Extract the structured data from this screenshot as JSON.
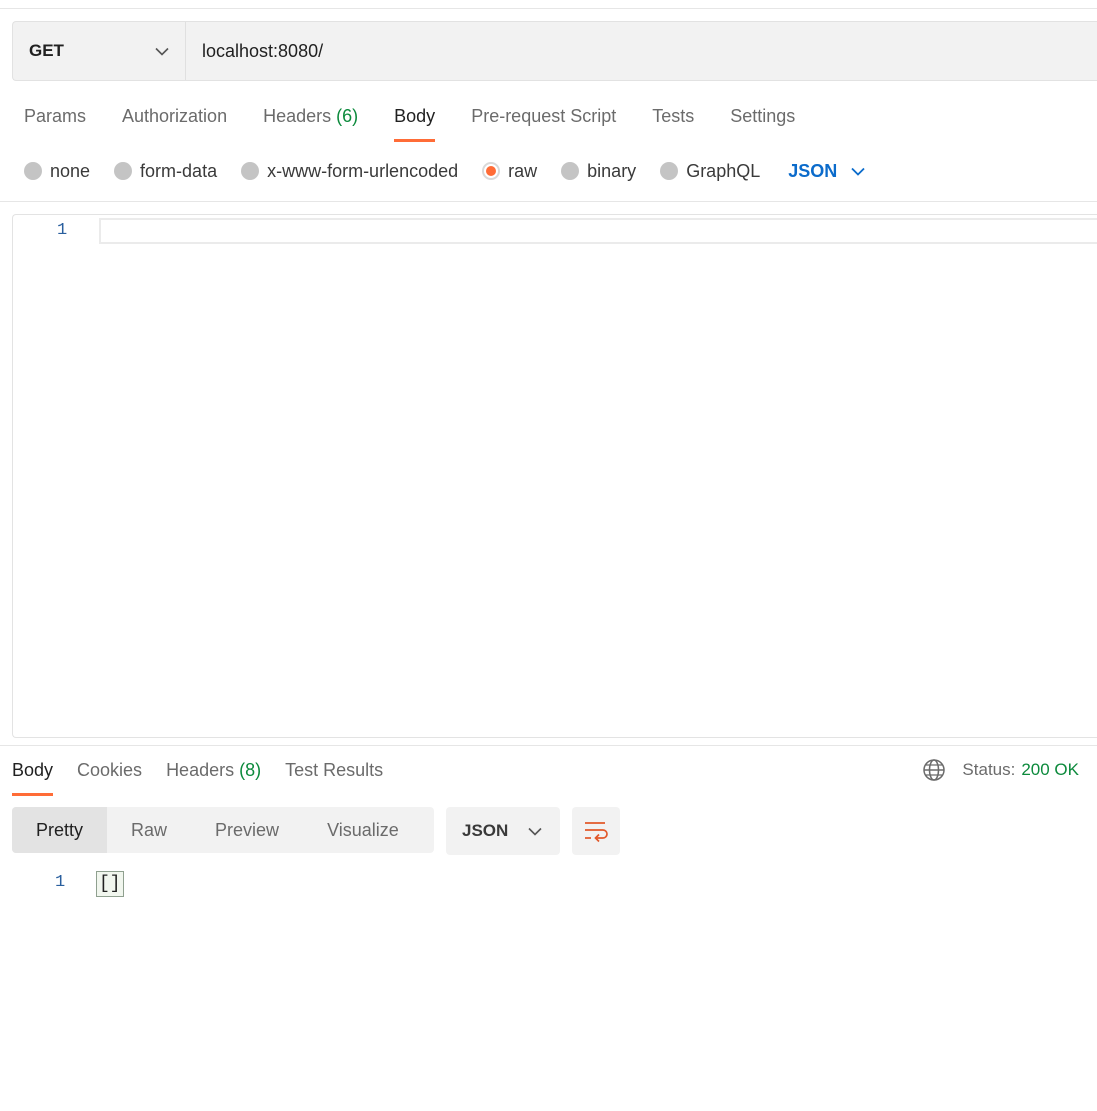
{
  "request": {
    "method": "GET",
    "url": "localhost:8080/"
  },
  "request_tabs": [
    {
      "label": "Params"
    },
    {
      "label": "Authorization"
    },
    {
      "label": "Headers",
      "count": "(6)"
    },
    {
      "label": "Body",
      "active": true
    },
    {
      "label": "Pre-request Script"
    },
    {
      "label": "Tests"
    },
    {
      "label": "Settings"
    }
  ],
  "body_types": [
    {
      "label": "none"
    },
    {
      "label": "form-data"
    },
    {
      "label": "x-www-form-urlencoded"
    },
    {
      "label": "raw",
      "selected": true
    },
    {
      "label": "binary"
    },
    {
      "label": "GraphQL"
    }
  ],
  "body_language": "JSON",
  "editor": {
    "line_number": "1",
    "content": ""
  },
  "response_tabs": [
    {
      "label": "Body",
      "active": true
    },
    {
      "label": "Cookies"
    },
    {
      "label": "Headers",
      "count": "(8)"
    },
    {
      "label": "Test Results"
    }
  ],
  "status": {
    "label": "Status:",
    "value": "200 OK"
  },
  "view_modes": [
    {
      "label": "Pretty",
      "active": true
    },
    {
      "label": "Raw"
    },
    {
      "label": "Preview"
    },
    {
      "label": "Visualize"
    }
  ],
  "response_format": "JSON",
  "response_body": {
    "line_number": "1",
    "content": "[]"
  },
  "colors": {
    "accent": "#ff6c37",
    "success": "#0c8a3c",
    "link": "#0b6bcb"
  },
  "icons": [
    "chevron-down-icon",
    "globe-icon",
    "wrap-lines-icon"
  ]
}
